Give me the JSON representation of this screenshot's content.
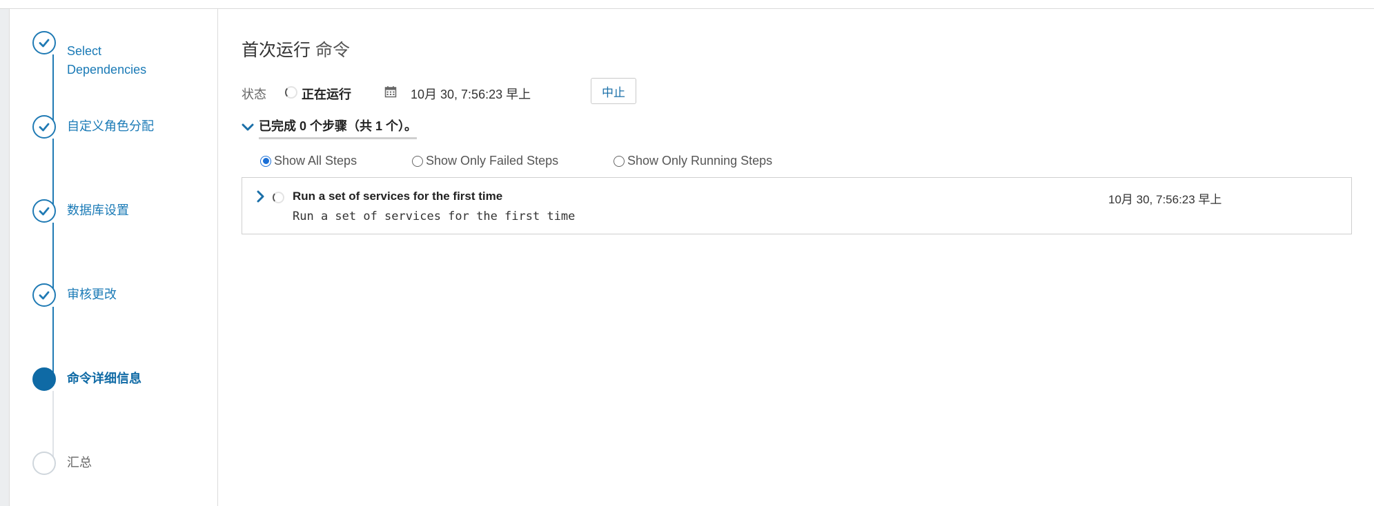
{
  "wizard": {
    "steps": [
      {
        "label_line1": "Select",
        "label_line2": "Dependencies",
        "state": "done"
      },
      {
        "label": "自定义角色分配",
        "state": "done"
      },
      {
        "label": "数据库设置",
        "state": "done"
      },
      {
        "label": "审核更改",
        "state": "done"
      },
      {
        "label": "命令详细信息",
        "state": "current"
      },
      {
        "label": "汇总",
        "state": "pending"
      }
    ]
  },
  "main": {
    "title_main": "首次运行",
    "title_suffix": "命令",
    "status_label": "状态",
    "status_value": "正在运行",
    "status_time": "10月 30, 7:56:23 早上",
    "abort_label": "中止",
    "steps_summary": "已完成 0 个步骤（共 1 个）。",
    "filters": [
      {
        "label": "Show All Steps",
        "checked": true
      },
      {
        "label": "Show Only Failed Steps",
        "checked": false
      },
      {
        "label": "Show Only Running Steps",
        "checked": false
      }
    ],
    "step_rows": [
      {
        "name": "Run a set of services for the first time",
        "description": "Run a set of services for the first time",
        "time": "10月 30, 7:56:23 早上"
      }
    ]
  },
  "colors": {
    "accent": "#1a7ab6",
    "current_step": "#0f6aa5",
    "radio_checked": "#1a6fd6"
  }
}
